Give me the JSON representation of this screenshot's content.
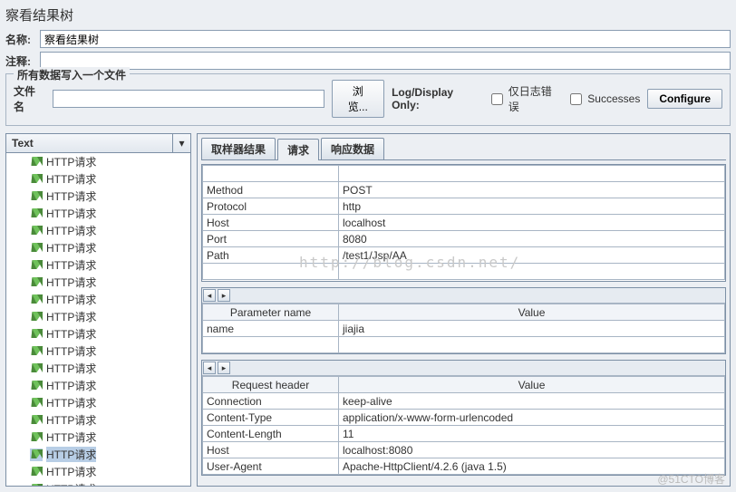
{
  "title": "察看结果树",
  "form": {
    "name_label": "名称:",
    "name_value": "察看结果树",
    "comment_label": "注释:",
    "comment_value": ""
  },
  "fileOutput": {
    "legend": "所有数据写入一个文件",
    "filename_label": "文件名",
    "filename_value": "",
    "browse_btn": "浏览...",
    "logdisplay_label": "Log/Display Only:",
    "only_errors_label": "仅日志错误",
    "successes_label": "Successes",
    "configure_btn": "Configure"
  },
  "tree": {
    "header": "Text",
    "items": [
      "HTTP请求",
      "HTTP请求",
      "HTTP请求",
      "HTTP请求",
      "HTTP请求",
      "HTTP请求",
      "HTTP请求",
      "HTTP请求",
      "HTTP请求",
      "HTTP请求",
      "HTTP请求",
      "HTTP请求",
      "HTTP请求",
      "HTTP请求",
      "HTTP请求",
      "HTTP请求",
      "HTTP请求",
      "HTTP请求",
      "HTTP请求",
      "HTTP请求"
    ],
    "selected_index": 17
  },
  "tabs": {
    "sampler_result": "取样器结果",
    "request": "请求",
    "response_data": "响应数据"
  },
  "request_info": {
    "rows": [
      {
        "k": "Method",
        "v": "POST"
      },
      {
        "k": "Protocol",
        "v": "http"
      },
      {
        "k": "Host",
        "v": "localhost"
      },
      {
        "k": "Port",
        "v": "8080"
      },
      {
        "k": "Path",
        "v": "/test1/Jsp/AA"
      }
    ]
  },
  "params": {
    "col_name": "Parameter name",
    "col_value": "Value",
    "rows": [
      {
        "name": "name",
        "value": "jiajia"
      }
    ]
  },
  "headers": {
    "col_name": "Request header",
    "col_value": "Value",
    "rows": [
      {
        "name": "Connection",
        "value": "keep-alive"
      },
      {
        "name": "Content-Type",
        "value": "application/x-www-form-urlencoded"
      },
      {
        "name": "Content-Length",
        "value": "11"
      },
      {
        "name": "Host",
        "value": "localhost:8080"
      },
      {
        "name": "User-Agent",
        "value": "Apache-HttpClient/4.2.6 (java 1.5)"
      }
    ]
  },
  "watermark": "http://blog.csdn.net/",
  "footer": "@51CTO博客"
}
